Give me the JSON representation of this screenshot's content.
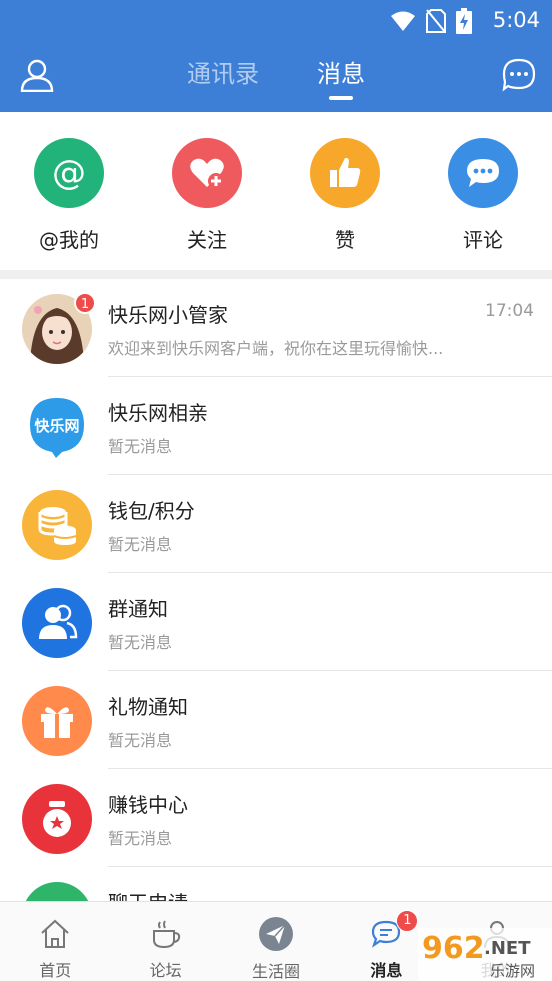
{
  "status_bar": {
    "time": "5:04"
  },
  "header": {
    "tabs": [
      {
        "label": "通讯录",
        "active": false
      },
      {
        "label": "消息",
        "active": true
      }
    ]
  },
  "quick_actions": [
    {
      "label": "@我的",
      "icon": "at-icon",
      "color": "#21b37a"
    },
    {
      "label": "关注",
      "icon": "heart-plus-icon",
      "color": "#ef5a5f"
    },
    {
      "label": "赞",
      "icon": "thumbs-up-icon",
      "color": "#f7a72a"
    },
    {
      "label": "评论",
      "icon": "comment-icon",
      "color": "#3a8fe4"
    }
  ],
  "messages": [
    {
      "title": "快乐网小管家",
      "subtitle": "欢迎来到快乐网客户端，祝你在这里玩得愉快...",
      "time": "17:04",
      "badge": "1",
      "icon": "girl-avatar"
    },
    {
      "title": "快乐网相亲",
      "subtitle": "暂无消息",
      "icon": "kuailewang-logo",
      "logo_text": "快乐网"
    },
    {
      "title": "钱包/积分",
      "subtitle": "暂无消息",
      "icon": "coins-icon"
    },
    {
      "title": "群通知",
      "subtitle": "暂无消息",
      "icon": "group-icon"
    },
    {
      "title": "礼物通知",
      "subtitle": "暂无消息",
      "icon": "gift-icon"
    },
    {
      "title": "赚钱中心",
      "subtitle": "暂无消息",
      "icon": "money-bag-icon"
    },
    {
      "title": "聊天申请",
      "subtitle": "",
      "icon": "chat-request-icon"
    }
  ],
  "bottom_nav": [
    {
      "label": "首页",
      "icon": "home-icon"
    },
    {
      "label": "论坛",
      "icon": "coffee-icon"
    },
    {
      "label": "生活圈",
      "icon": "paper-plane-icon"
    },
    {
      "label": "消息",
      "icon": "message-icon",
      "badge": "1",
      "active": true
    },
    {
      "label": "我的",
      "icon": "user-icon"
    }
  ],
  "watermark": {
    "number": "962",
    "suffix": ".NET",
    "sub": "乐游网"
  },
  "colors": {
    "primary": "#3d7fd6",
    "badge": "#ee4b4b"
  }
}
